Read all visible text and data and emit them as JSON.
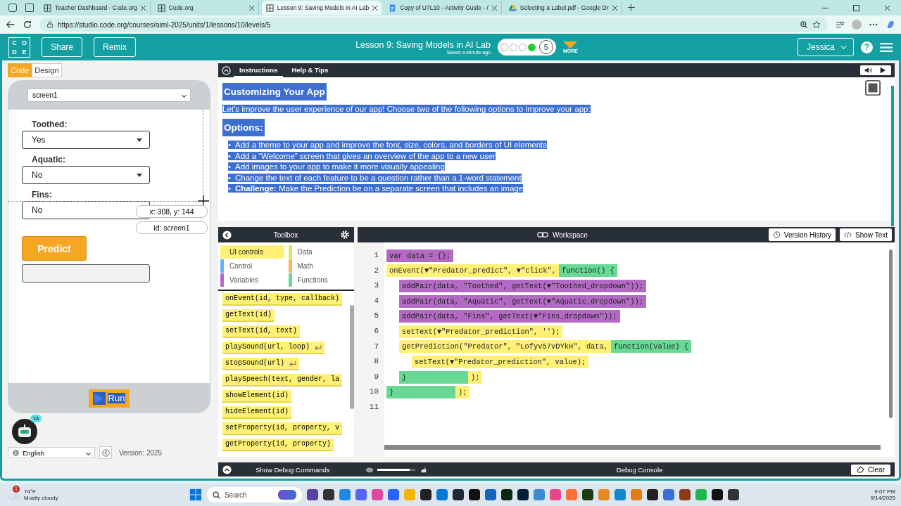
{
  "browser": {
    "tabs": [
      {
        "kind": "codeorg",
        "title": "Teacher Dashboard - Code.org",
        "selected": false
      },
      {
        "kind": "codeorg",
        "title": "Code.org",
        "selected": false
      },
      {
        "kind": "codeorg",
        "title": "Lesson 9: Saving Models in AI Lab",
        "selected": true
      },
      {
        "kind": "docs",
        "title": "Copy of U7L10 - Activity Guide - /",
        "selected": false
      },
      {
        "kind": "drive",
        "title": "Selecting a Label.pdf - Google Dr",
        "selected": false
      }
    ],
    "url": "https://studio.code.org/courses/aiml-2025/units/1/lessons/10/levels/5"
  },
  "header": {
    "logo": [
      "C",
      "O",
      "D",
      "E"
    ],
    "buttons": [
      "Share",
      "Remix"
    ],
    "title": "Lesson 9: Saving Models in AI Lab",
    "saved": "Saved a minute ago",
    "progress": [
      {
        "completed": false
      },
      {
        "completed": false
      },
      {
        "completed": false
      },
      {
        "completed": true
      }
    ],
    "current_level": "5",
    "more": "MORE",
    "user": "Jessica",
    "help": "?"
  },
  "mode_toggle": [
    {
      "label": "Code",
      "selected": true
    },
    {
      "label": "Design",
      "selected": false
    }
  ],
  "app_preview": {
    "screen_select": "screen1",
    "fields": [
      {
        "label": "Toothed:",
        "value": "Yes"
      },
      {
        "label": "Aquatic:",
        "value": "No"
      },
      {
        "label": "Fins:",
        "value": "No"
      }
    ],
    "coordinates": "x: 308, y: 144",
    "element_id": "id: screen1",
    "predict_button": "Predict",
    "run_button": "Run"
  },
  "footer": {
    "ta_badge": "TA",
    "language": "English",
    "version": "Version: 2025"
  },
  "instructions": {
    "tabs": [
      {
        "label": "Instructions",
        "selected": true
      },
      {
        "label": "Help & Tips",
        "selected": false
      }
    ],
    "highlighted": true,
    "title": "Customizing Your App",
    "bullet": "•",
    "intro": "Let’s improve the user experience of our app! Choose two of the following options to improve your app:",
    "options_heading": "Options:",
    "options": [
      "Add a theme to your app and improve the font, size, colors, and borders of UI elements",
      "Add a “Welcome” screen that gives an overview of the app to a new user",
      "Add images to your app to make it more visually appealing",
      "Change the text of each feature to be a question rather than a 1-word statement",
      "**Challenge:** Make the Prediction be on a separate screen that includes an image"
    ]
  },
  "toolbox": {
    "title": "Toolbox",
    "categories": [
      {
        "label": "UI controls",
        "color": "#fff176",
        "selected": true
      },
      {
        "label": "Data",
        "color": "#d3e965",
        "selected": false
      },
      {
        "label": "Control",
        "color": "#64b5f6",
        "selected": false
      },
      {
        "label": "Math",
        "color": "#ffb74d",
        "selected": false
      },
      {
        "label": "Variables",
        "color": "#ba68c8",
        "selected": false
      },
      {
        "label": "Functions",
        "color": "#68d995",
        "selected": false
      }
    ],
    "blocks": [
      {
        "text": "onEvent(id, type, callback)",
        "returns": false
      },
      {
        "text": "getText(id)",
        "returns": false
      },
      {
        "text": "setText(id, text)",
        "returns": false
      },
      {
        "text": "playSound(url, loop)",
        "returns": true
      },
      {
        "text": "stopSound(url)",
        "returns": true
      },
      {
        "text": "playSpeech(text, gender, la",
        "returns": false
      },
      {
        "text": "showElement(id)",
        "returns": false
      },
      {
        "text": "hideElement(id)",
        "returns": false
      },
      {
        "text": "setProperty(id, property, v",
        "returns": false
      },
      {
        "text": "getProperty(id, property)",
        "returns": false
      }
    ]
  },
  "workspace": {
    "title": "Workspace",
    "buttons": [
      "Version History",
      "Show Text"
    ],
    "line_numbers": [
      "1",
      "2",
      "3",
      "4",
      "5",
      "6",
      "7",
      "8",
      "9",
      "10",
      "11"
    ],
    "code": [
      {
        "kind": "variables",
        "text": "var data = {};"
      },
      {
        "kind": "ui",
        "text": "onEvent(▼\"Predator_predict\", ▼\"click\",",
        "function": "function() {",
        "close": "}",
        "end": ");",
        "children": [
          {
            "kind": "variables",
            "text": "addPair(data, \"Toothed\", getText(▼\"Toothed_dropdown\"));"
          },
          {
            "kind": "variables",
            "text": "addPair(data, \"Aquatic\", getText(▼\"Aquatic_dropdown\"));"
          },
          {
            "kind": "variables",
            "text": "addPair(data, \"Fins\", getText(▼\"Fins_dropdown\"));"
          },
          {
            "kind": "ui",
            "text": "setText(▼\"Predator_prediction\", '');"
          },
          {
            "kind": "ui",
            "text": "getPrediction(\"Predator\", \"Lofyv57vDYkH\", data,",
            "function": "function(value) {",
            "close": "}",
            "end": ");",
            "children": [
              {
                "kind": "ui",
                "text": "setText(▼\"Predator_prediction\", value);"
              }
            ]
          }
        ]
      }
    ]
  },
  "debug": {
    "show_commands": "Show Debug Commands",
    "speed_slider": {
      "level": 0.85
    },
    "console": "Debug Console",
    "clear": "Clear"
  },
  "taskbar": {
    "weather_badge": "1",
    "temperature": "74°F",
    "weather": "Mostly cloudy",
    "search": "Search",
    "time": "9:07 PM",
    "date": "9/14/2025"
  }
}
